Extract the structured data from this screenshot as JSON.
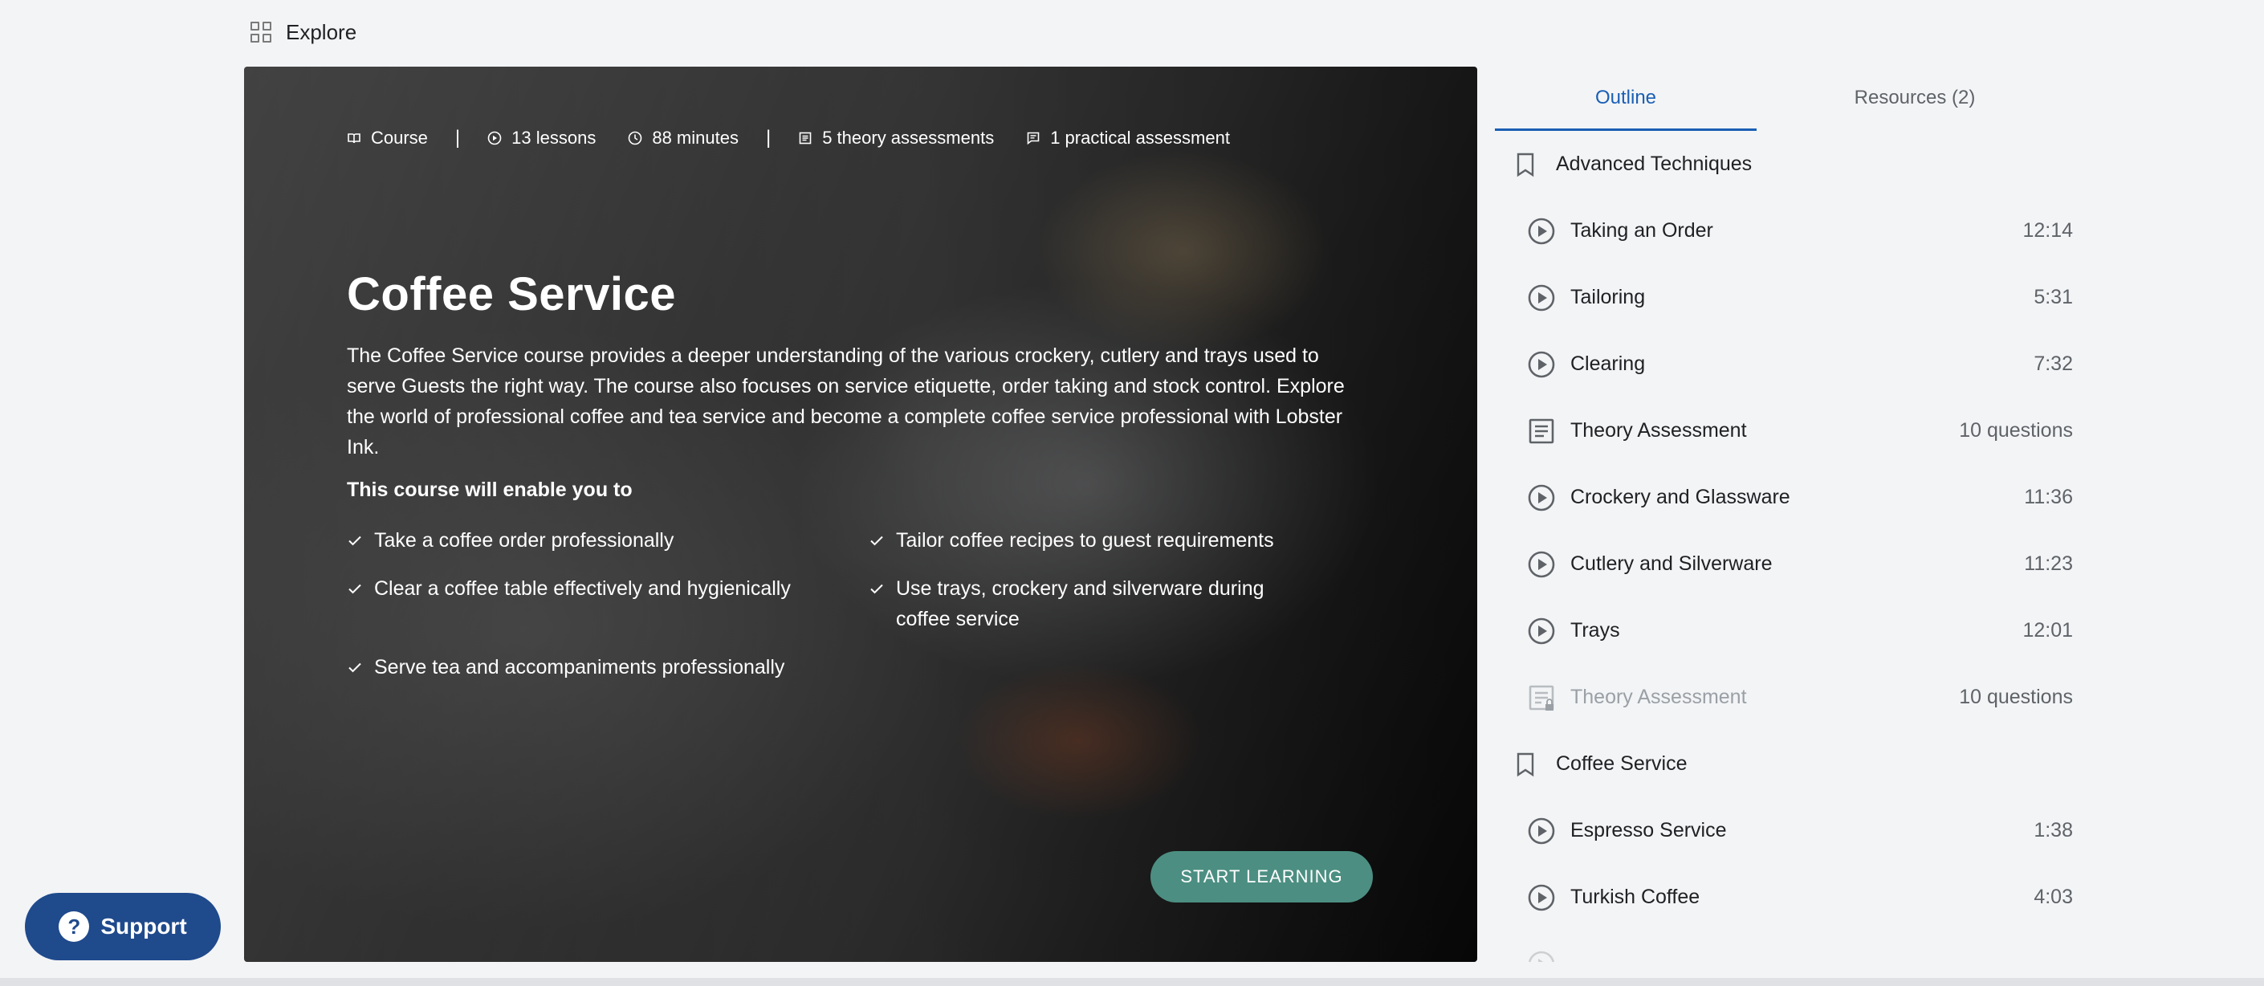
{
  "topbar": {
    "explore_label": "Explore"
  },
  "hero": {
    "meta": {
      "type": "Course",
      "lessons": "13 lessons",
      "duration": "88 minutes",
      "theory": "5 theory assessments",
      "practical": "1 practical assessment",
      "separator": "|"
    },
    "title": "Coffee Service",
    "description": "The Coffee Service course provides a deeper understanding of the various crockery, cutlery and trays used to serve Guests the right way. The course also focuses on service etiquette, order taking and stock control. Explore the world of professional coffee and tea service and become a complete coffee service professional with Lobster Ink.",
    "enable_heading": "This course will enable you to",
    "goals": [
      "Take a coffee order professionally",
      "Tailor coffee recipes to guest requirements",
      "Clear a coffee table effectively and hygienically",
      "Use trays, crockery and silverware during coffee service",
      "Serve tea and accompaniments professionally"
    ],
    "start_label": "START LEARNING"
  },
  "tabs": {
    "outline": "Outline",
    "resources": "Resources (2)"
  },
  "outline": {
    "sections": [
      {
        "label": "Advanced Techniques"
      },
      {
        "label": "Coffee Service"
      }
    ],
    "items": [
      {
        "label": "Taking an Order",
        "meta": "12:14",
        "icon": "play-circle-icon"
      },
      {
        "label": "Tailoring",
        "meta": "5:31",
        "icon": "play-circle-icon"
      },
      {
        "label": "Clearing",
        "meta": "7:32",
        "icon": "play-circle-icon"
      },
      {
        "label": "Theory Assessment",
        "meta": "10 questions",
        "icon": "document-icon"
      },
      {
        "label": "Crockery and Glassware",
        "meta": "11:36",
        "icon": "play-circle-icon"
      },
      {
        "label": "Cutlery and Silverware",
        "meta": "11:23",
        "icon": "play-circle-icon"
      },
      {
        "label": "Trays",
        "meta": "12:01",
        "icon": "play-circle-icon"
      },
      {
        "label": "Theory Assessment",
        "meta": "10 questions",
        "icon": "locked-document-icon"
      },
      {
        "label": "Espresso Service",
        "meta": "1:38",
        "icon": "play-circle-icon"
      },
      {
        "label": "Turkish Coffee",
        "meta": "4:03",
        "icon": "play-circle-icon"
      }
    ]
  },
  "support": {
    "label": "Support"
  }
}
